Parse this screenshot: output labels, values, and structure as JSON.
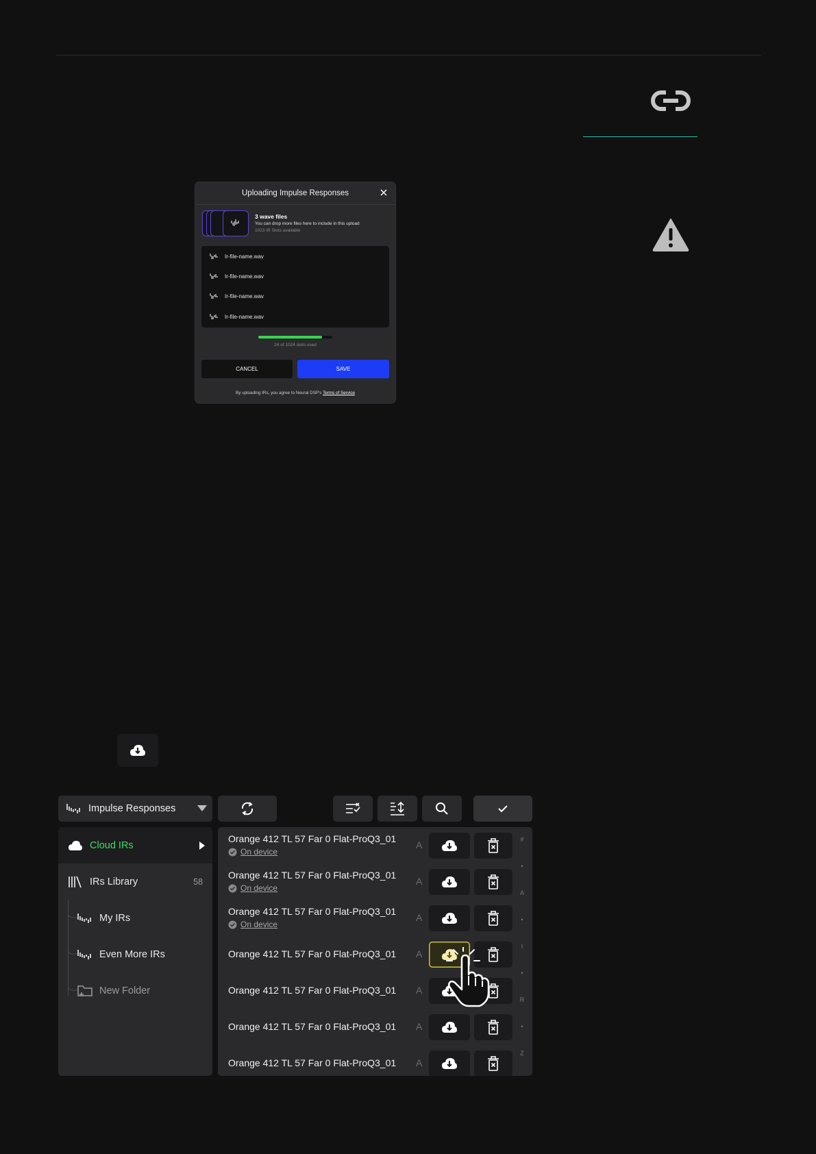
{
  "modal": {
    "title": "Uploading Impulse Responses",
    "files_title": "3 wave files",
    "files_subtitle": "You can drop more files here to include in this upload",
    "slots_available": "1023 IR Slots available",
    "files": [
      "Ir-file-name.wav",
      "Ir-file-name.wav",
      "Ir-file-name.wav",
      "Ir-file-name.wav"
    ],
    "progress_fraction": 0.86,
    "progress_label": "24 of 1024 slots used",
    "cancel_label": "CANCEL",
    "save_label": "SAVE",
    "legal_text": "By uploading IRs, you agree to Neural DSP's ",
    "legal_link": "Terms of Service"
  },
  "toolbar": {
    "select_label": "Impulse Responses"
  },
  "sidebar": {
    "items": [
      {
        "label": "Cloud IRs",
        "count": "",
        "icon": "cloud-icon",
        "color": "#3ddc62"
      },
      {
        "label": "IRs Library",
        "count": "58",
        "icon": "library-icon"
      },
      {
        "label": "My IRs",
        "count": "",
        "icon": "waveform-icon"
      },
      {
        "label": "Even More IRs",
        "count": "",
        "icon": "waveform-icon"
      },
      {
        "label": "New Folder",
        "count": "",
        "icon": "new-folder-icon"
      }
    ]
  },
  "list": {
    "rows": [
      {
        "name": "Orange 412 TL 57 Far 0 Flat-ProQ3_01",
        "status": "On device",
        "letter": "A"
      },
      {
        "name": "Orange 412 TL 57 Far 0 Flat-ProQ3_01",
        "status": "On device",
        "letter": "A"
      },
      {
        "name": "Orange 412 TL 57 Far 0 Flat-ProQ3_01",
        "status": "On device",
        "letter": "A"
      },
      {
        "name": "Orange 412 TL 57 Far 0 Flat-ProQ3_01",
        "status": "",
        "letter": "A"
      },
      {
        "name": "Orange 412 TL 57 Far 0 Flat-ProQ3_01",
        "status": "",
        "letter": "A"
      },
      {
        "name": "Orange 412 TL 57 Far 0 Flat-ProQ3_01",
        "status": "",
        "letter": "A"
      },
      {
        "name": "Orange 412 TL 57 Far 0 Flat-ProQ3_01",
        "status": "",
        "letter": "A"
      }
    ],
    "index_letters": [
      "#",
      "•",
      "A",
      "•",
      "I",
      "•",
      "R",
      "•",
      "Z"
    ]
  },
  "colors": {
    "accent_blue": "#1c3cf5",
    "accent_green": "#3ddc62",
    "highlight_yellow": "#c9c23a"
  }
}
